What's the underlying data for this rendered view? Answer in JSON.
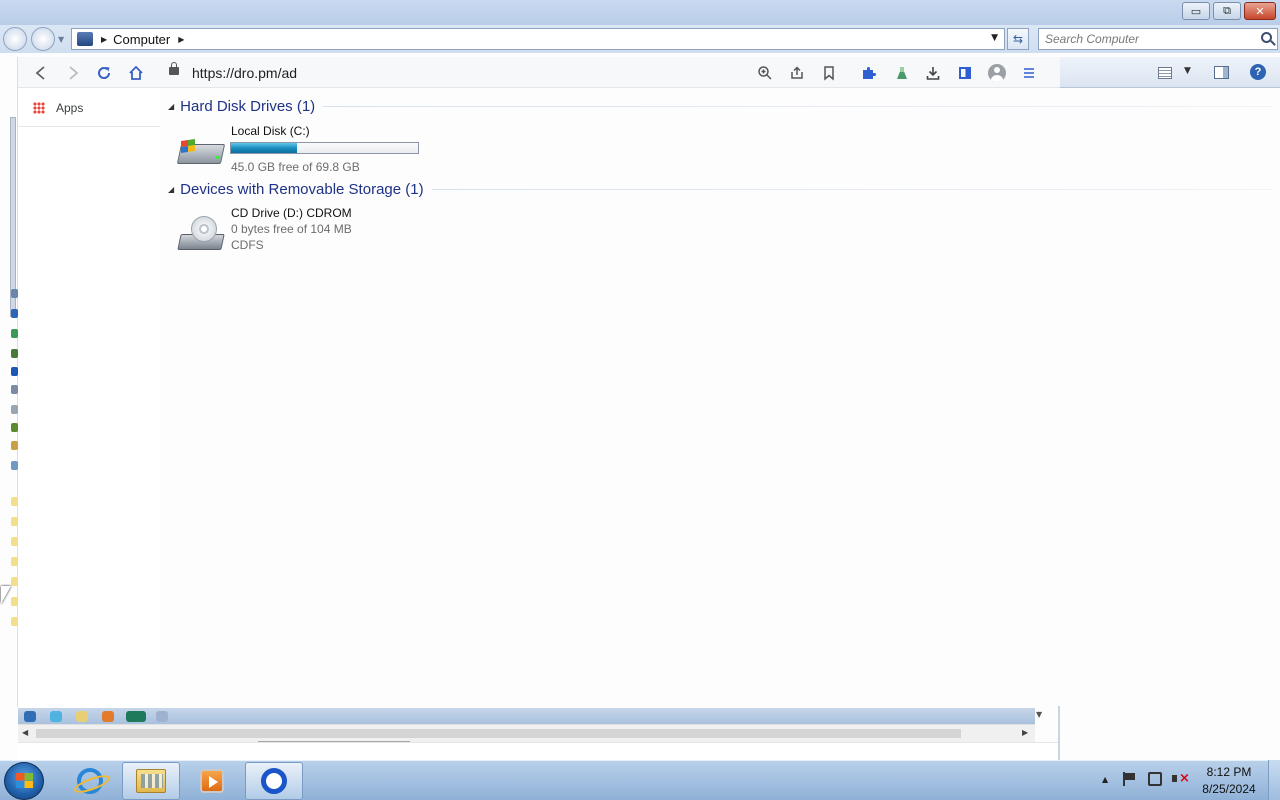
{
  "explorer": {
    "window_buttons": {
      "minimize": "▭",
      "maximize": "⧉",
      "close": "✕"
    },
    "breadcrumb": {
      "location": "Computer"
    },
    "search": {
      "placeholder": "Search Computer"
    },
    "toolbar_icons": [
      "view-options-icon",
      "preview-pane-icon",
      "help-icon"
    ]
  },
  "browser": {
    "url": "https://dro.pm/ad",
    "toolbar_icons": [
      "back-icon",
      "forward-icon",
      "reload-icon",
      "home-icon",
      "lock-icon",
      "zoom-icon",
      "share-icon",
      "bookmark-icon",
      "extensions-icon",
      "labs-icon",
      "download-icon",
      "side-panel-icon",
      "profile-icon",
      "menu-icon"
    ],
    "accent_color": "#3a61c4",
    "bookmarks": {
      "apps_label": "Apps"
    }
  },
  "content": {
    "groups": [
      {
        "title": "Hard Disk Drives (1)"
      },
      {
        "title": "Devices with Removable Storage (1)"
      }
    ],
    "drives": [
      {
        "name": "Local Disk (C:)",
        "free_text": "45.0 GB free of 69.8 GB",
        "used_fraction": 0.355,
        "bar_color": "#1b8fbf"
      },
      {
        "name": "CD Drive (D:) CDROM",
        "free_text": "0 bytes free of 104 MB",
        "filesystem": "CDFS"
      }
    ]
  },
  "taskbar": {
    "apps": [
      "internet-explorer",
      "windows-explorer",
      "media-player",
      "chrome"
    ],
    "active_apps": [
      "windows-explorer",
      "chrome"
    ],
    "clock": {
      "time": "8:12 PM",
      "date": "8/25/2024"
    }
  }
}
